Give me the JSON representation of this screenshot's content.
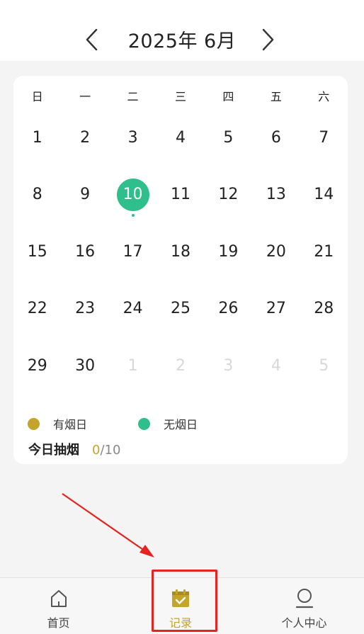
{
  "header": {
    "month_title": "2025年 6月"
  },
  "calendar": {
    "weekdays": [
      "日",
      "一",
      "二",
      "三",
      "四",
      "五",
      "六"
    ],
    "days": [
      {
        "label": "1",
        "state": "current"
      },
      {
        "label": "2",
        "state": "current"
      },
      {
        "label": "3",
        "state": "current"
      },
      {
        "label": "4",
        "state": "current"
      },
      {
        "label": "5",
        "state": "current"
      },
      {
        "label": "6",
        "state": "current"
      },
      {
        "label": "7",
        "state": "current"
      },
      {
        "label": "8",
        "state": "current"
      },
      {
        "label": "9",
        "state": "current"
      },
      {
        "label": "10",
        "state": "selected",
        "dot": true
      },
      {
        "label": "11",
        "state": "current"
      },
      {
        "label": "12",
        "state": "current"
      },
      {
        "label": "13",
        "state": "current"
      },
      {
        "label": "14",
        "state": "current"
      },
      {
        "label": "15",
        "state": "current"
      },
      {
        "label": "16",
        "state": "current"
      },
      {
        "label": "17",
        "state": "current"
      },
      {
        "label": "18",
        "state": "current"
      },
      {
        "label": "19",
        "state": "current"
      },
      {
        "label": "20",
        "state": "current"
      },
      {
        "label": "21",
        "state": "current"
      },
      {
        "label": "22",
        "state": "current"
      },
      {
        "label": "23",
        "state": "current"
      },
      {
        "label": "24",
        "state": "current"
      },
      {
        "label": "25",
        "state": "current"
      },
      {
        "label": "26",
        "state": "current"
      },
      {
        "label": "27",
        "state": "current"
      },
      {
        "label": "28",
        "state": "current"
      },
      {
        "label": "29",
        "state": "current"
      },
      {
        "label": "30",
        "state": "current"
      },
      {
        "label": "1",
        "state": "other"
      },
      {
        "label": "2",
        "state": "other"
      },
      {
        "label": "3",
        "state": "other"
      },
      {
        "label": "4",
        "state": "other"
      },
      {
        "label": "5",
        "state": "other"
      }
    ]
  },
  "legend": {
    "smoke_day": {
      "label": "有烟日",
      "color": "#c4a42a"
    },
    "smoke_free_day": {
      "label": "无烟日",
      "color": "#2fbf8c"
    }
  },
  "today": {
    "label": "今日抽烟",
    "count": "0",
    "separator": "/",
    "limit": "10"
  },
  "tabbar": {
    "home": {
      "label": "首页",
      "icon": "home-icon"
    },
    "records": {
      "label": "记录",
      "icon": "calendar-check-icon",
      "active": true
    },
    "profile": {
      "label": "个人中心",
      "icon": "user-icon"
    }
  },
  "colors": {
    "accent": "#c4a42a",
    "green": "#2fbf8c",
    "highlight": "#e5231f"
  }
}
